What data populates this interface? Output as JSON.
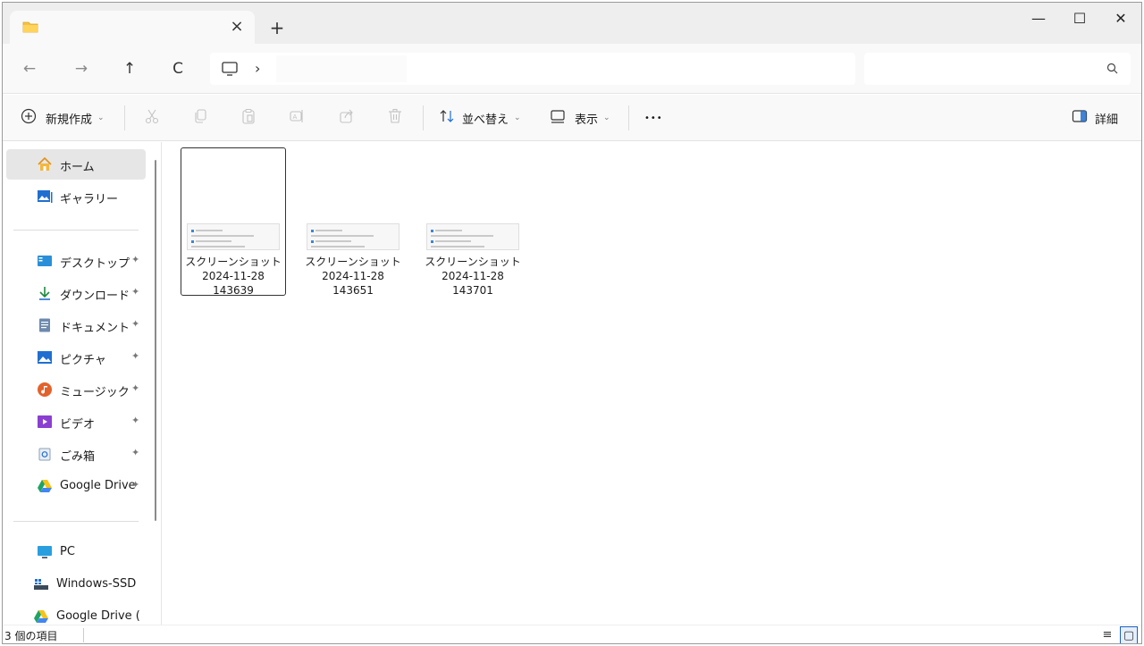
{
  "titlebar": {
    "tab_close": "×",
    "new_tab": "+",
    "minimize": "—",
    "maximize": "☐",
    "close": "✕"
  },
  "address": {
    "back": "←",
    "forward": "→",
    "up": "↑",
    "refresh": "C",
    "chevron": "›",
    "search_placeholder": ""
  },
  "toolbar": {
    "new_label": "新規作成",
    "sort_label": "並べ替え",
    "view_label": "表示",
    "more_label": "•••",
    "details_label": "詳細"
  },
  "sidebar": {
    "quick": [
      {
        "label": "ホーム",
        "icon": "home-icon",
        "pinned": false
      },
      {
        "label": "ギャラリー",
        "icon": "gallery-icon",
        "pinned": false
      }
    ],
    "pinned": [
      {
        "label": "デスクトップ",
        "icon": "desktop-icon"
      },
      {
        "label": "ダウンロード",
        "icon": "download-icon"
      },
      {
        "label": "ドキュメント",
        "icon": "documents-icon"
      },
      {
        "label": "ピクチャ",
        "icon": "pictures-icon"
      },
      {
        "label": "ミュージック",
        "icon": "music-icon"
      },
      {
        "label": "ビデオ",
        "icon": "videos-icon"
      },
      {
        "label": "ごみ箱",
        "icon": "recycle-bin-icon"
      },
      {
        "label": "Google Drive",
        "icon": "google-drive-icon"
      }
    ],
    "pin_glyph": "📌",
    "tree": [
      {
        "label": "PC",
        "chevron": "⌄"
      },
      {
        "label": "Windows-SSD",
        "chevron": "›"
      },
      {
        "label": "Google Drive (",
        "chevron": "›"
      }
    ]
  },
  "files": [
    {
      "name_line1": "スクリーンショット",
      "name_line2": "2024-11-28",
      "name_line3": "143639",
      "selected": true
    },
    {
      "name_line1": "スクリーンショット",
      "name_line2": "2024-11-28",
      "name_line3": "143651",
      "selected": false
    },
    {
      "name_line1": "スクリーンショット",
      "name_line2": "2024-11-28",
      "name_line3": "143701",
      "selected": false
    }
  ],
  "status": {
    "item_count": "3 個の項目"
  },
  "colors": {
    "folder": "#f6c343",
    "accent": "#1f6fd1",
    "selection": "#e6e6e6"
  }
}
